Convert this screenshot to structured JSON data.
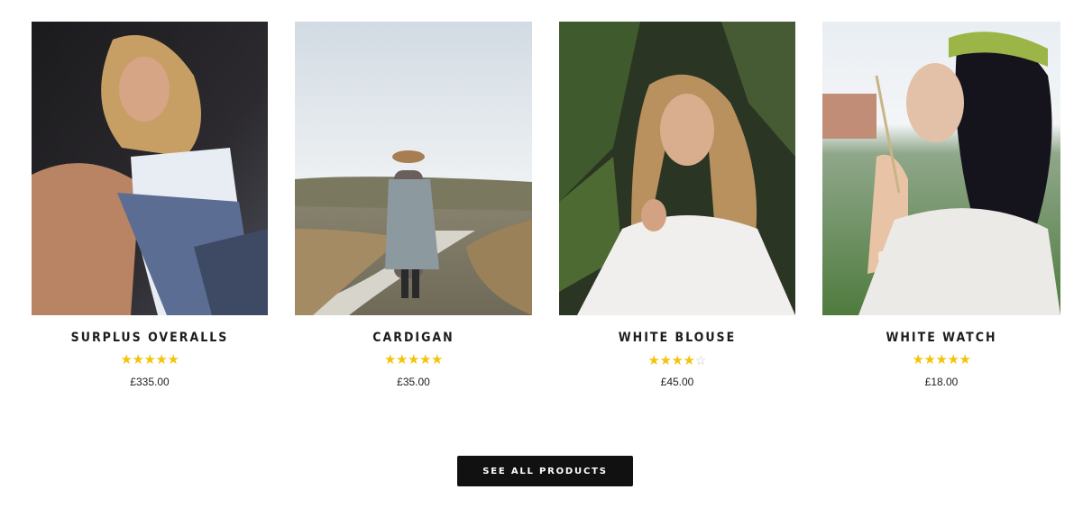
{
  "products": [
    {
      "name": "SURPLUS OVERALLS",
      "rating": 5,
      "price": "£335.00",
      "image": "photo-woman-overalls"
    },
    {
      "name": "CARDIGAN",
      "rating": 5,
      "price": "£35.00",
      "image": "photo-woman-road-cardigan"
    },
    {
      "name": "WHITE BLOUSE",
      "rating": 4,
      "price": "£45.00",
      "image": "photo-woman-white-blouse"
    },
    {
      "name": "WHITE WATCH",
      "rating": 5,
      "price": "£18.00",
      "image": "photo-woman-flower-crown"
    }
  ],
  "cta": {
    "label": "SEE ALL PRODUCTS"
  },
  "colors": {
    "star": "#f3c40a",
    "button": "#111111"
  }
}
